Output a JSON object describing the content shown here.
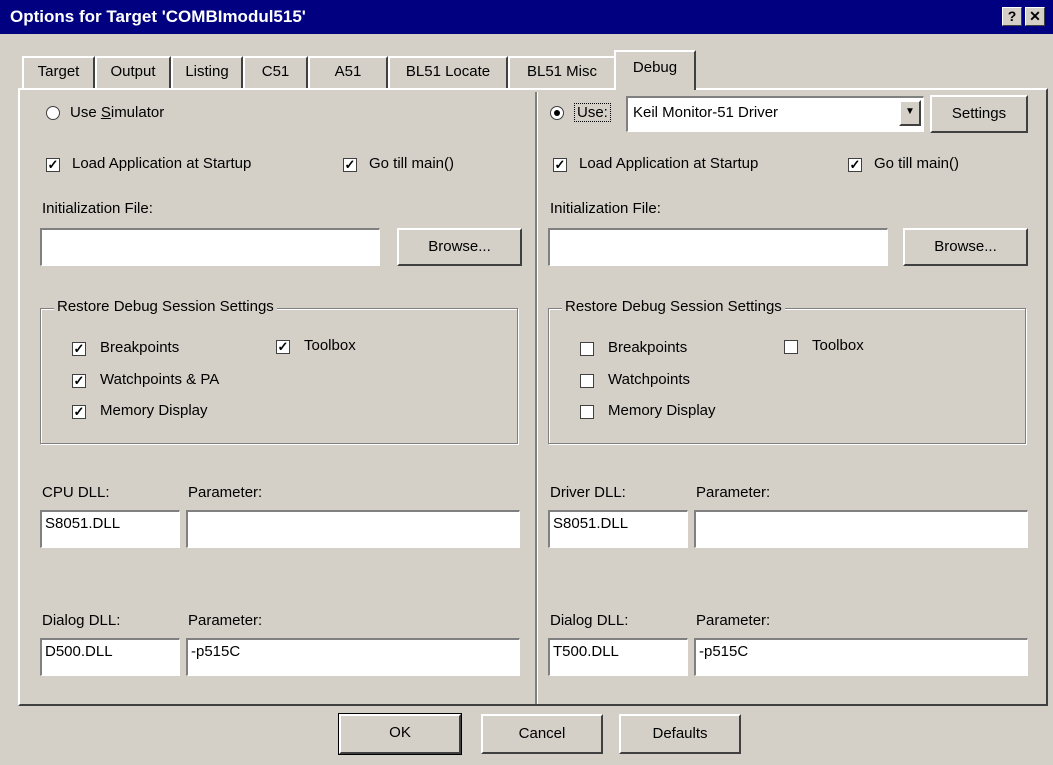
{
  "window": {
    "title": "Options for Target 'COMBImodul515'",
    "help_label": "?",
    "close_label": "✕"
  },
  "tabs": [
    "Target",
    "Output",
    "Listing",
    "C51",
    "A51",
    "BL51 Locate",
    "BL51 Misc",
    "Debug"
  ],
  "active_tab": "Debug",
  "left": {
    "use_simulator_pre": "Use ",
    "use_simulator_u": "S",
    "use_simulator_post": "imulator",
    "load_app": "Load Application at Startup",
    "go_till_main": "Go  till main()",
    "init_file_label": "Initialization File:",
    "init_file_value": "",
    "browse": "Browse...",
    "restore_title": "Restore Debug Session Settings",
    "breakpoints": "Breakpoints",
    "toolbox": "Toolbox",
    "watchpoints": "Watchpoints & PA",
    "memory_display": "Memory Display",
    "cpu_dll_label": "CPU DLL:",
    "cpu_dll_value": "S8051.DLL",
    "cpu_param_label": "Parameter:",
    "cpu_param_value": "",
    "dialog_dll_label": "Dialog DLL:",
    "dialog_dll_value": "D500.DLL",
    "dialog_param_label": "Parameter:",
    "dialog_param_value": "-p515C"
  },
  "right": {
    "use_label": "Use:",
    "driver_select": "Keil Monitor-51 Driver",
    "settings": "Settings",
    "load_app": "Load Application at Startup",
    "go_till_main": "Go  till main()",
    "init_file_label": "Initialization File:",
    "init_file_value": "",
    "browse": "Browse...",
    "restore_title": "Restore Debug Session Settings",
    "breakpoints": "Breakpoints",
    "toolbox": "Toolbox",
    "watchpoints": "Watchpoints",
    "memory_display": "Memory Display",
    "driver_dll_label": "Driver DLL:",
    "driver_dll_value": "S8051.DLL",
    "driver_param_label": "Parameter:",
    "driver_param_value": "",
    "dialog_dll_label": "Dialog DLL:",
    "dialog_dll_value": "T500.DLL",
    "dialog_param_label": "Parameter:",
    "dialog_param_value": "-p515C"
  },
  "footer": {
    "ok": "OK",
    "cancel": "Cancel",
    "defaults": "Defaults"
  },
  "check_glyph": "✓",
  "colors": {
    "title_bar": "#000080",
    "face": "#d4d0c8"
  }
}
